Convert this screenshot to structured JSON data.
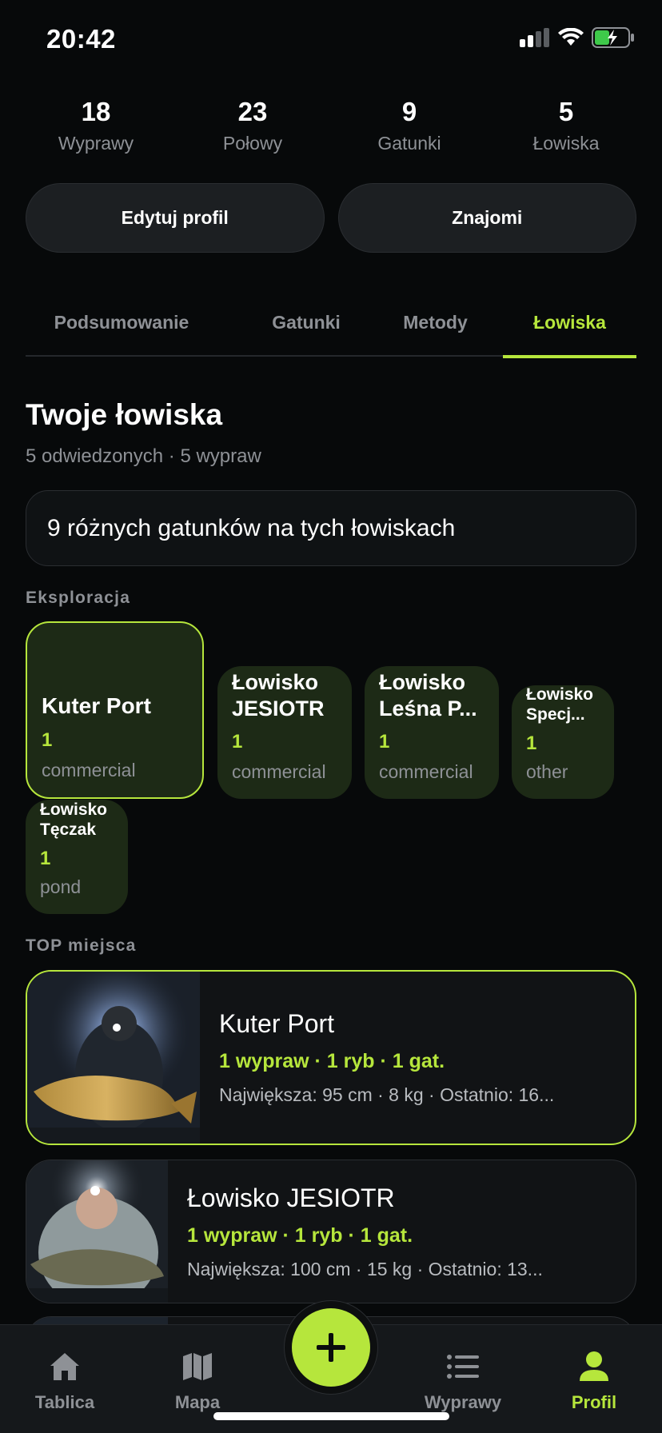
{
  "status_bar": {
    "time": "20:42"
  },
  "stats": [
    {
      "value": "18",
      "label": "Wyprawy"
    },
    {
      "value": "23",
      "label": "Połowy"
    },
    {
      "value": "9",
      "label": "Gatunki"
    },
    {
      "value": "5",
      "label": "Łowiska"
    }
  ],
  "actions": {
    "edit_profile": "Edytuj profil",
    "friends": "Znajomi"
  },
  "tabs": [
    {
      "label": "Podsumowanie"
    },
    {
      "label": "Gatunki"
    },
    {
      "label": "Metody"
    },
    {
      "label": "Łowiska",
      "active": true
    }
  ],
  "section": {
    "title": "Twoje łowiska",
    "subtitle": "5 odwiedzonych · 5 wypraw",
    "info_card": "9 różnych gatunków na tych łowiskach"
  },
  "exploration": {
    "label": "Eksploracja",
    "chips": [
      {
        "name": "Kuter Port",
        "count": "1",
        "type": "commercial"
      },
      {
        "name": "Łowisko JESIOTR",
        "count": "1",
        "type": "commercial"
      },
      {
        "name": "Łowisko Leśna P...",
        "count": "1",
        "type": "commercial"
      },
      {
        "name": "Łowisko Specj...",
        "count": "1",
        "type": "other"
      },
      {
        "name": "Łowisko Tęczak",
        "count": "1",
        "type": "pond"
      }
    ]
  },
  "top_places": {
    "label": "TOP miejsca",
    "items": [
      {
        "name": "Kuter Port",
        "stats": "1 wypraw · 1 ryb · 1 gat.",
        "detail": "Największa: 95 cm · 8 kg · Ostatnio: 16..."
      },
      {
        "name": "Łowisko JESIOTR",
        "stats": "1 wypraw · 1 ryb · 1 gat.",
        "detail": "Największa: 100 cm · 15 kg · Ostatnio: 13..."
      }
    ]
  },
  "bottom_nav": {
    "items": [
      {
        "label": "Tablica",
        "icon": "home-icon"
      },
      {
        "label": "Mapa",
        "icon": "map-icon"
      },
      {
        "label": "Wyprawy",
        "icon": "list-icon"
      },
      {
        "label": "Profil",
        "icon": "person-icon",
        "active": true
      }
    ],
    "fab_icon": "plus-icon"
  },
  "colors": {
    "accent": "#b6e63c",
    "background": "#07090a",
    "card": "#111315",
    "chip": "#1d2a16"
  }
}
